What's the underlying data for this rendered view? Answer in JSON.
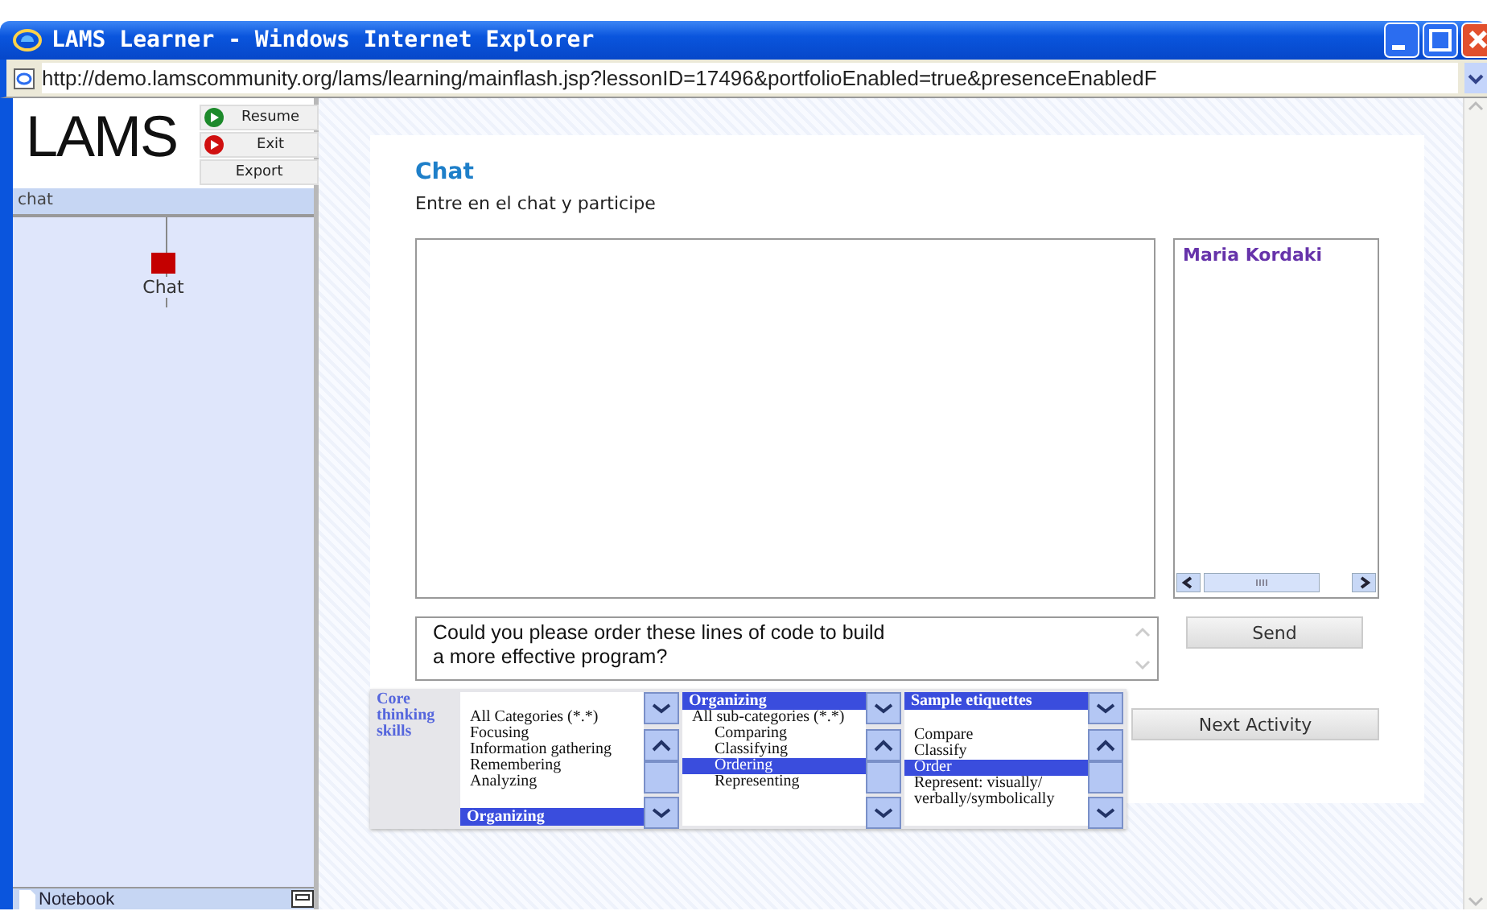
{
  "window": {
    "title": "LAMS Learner - Windows Internet Explorer",
    "address": "http://demo.lamscommunity.org/lams/learning/mainflash.jsp?lessonID=17496&portfolioEnabled=true&presenceEnabledF"
  },
  "sidebar": {
    "logo": "LAMS",
    "buttons": [
      {
        "label": "Resume",
        "kind": "resume"
      },
      {
        "label": "Exit",
        "kind": "exit"
      },
      {
        "label": "Export",
        "kind": "plain"
      }
    ],
    "section": "chat",
    "activities": [
      {
        "label": "Chat",
        "selected": true
      }
    ],
    "notebook": "Notebook"
  },
  "activity": {
    "title": "Chat",
    "instructions": "Entre en el chat y participe",
    "users": [
      "Maria Kordaki"
    ],
    "message": "Could you please order these lines of code to build\na more effective program?",
    "send": "Send",
    "next": "Next Activity"
  },
  "skills_panel": {
    "label": "Core thinking skills",
    "lists": [
      {
        "value": "Organizing",
        "kind": "trailing",
        "options": [
          {
            "label": "All Categories (*.*)",
            "selected": false
          },
          {
            "label": "Focusing",
            "selected": false
          },
          {
            "label": "Information gathering",
            "selected": false
          },
          {
            "label": "Remembering",
            "selected": false
          },
          {
            "label": "Analyzing",
            "selected": false
          }
        ]
      },
      {
        "value": "Organizing",
        "kind": "leading",
        "options": [
          {
            "label": "All sub-categories (*.*)",
            "selected": false,
            "children": [
              {
                "label": "Comparing",
                "selected": false
              },
              {
                "label": "Classifying",
                "selected": false
              },
              {
                "label": "Ordering",
                "selected": true
              },
              {
                "label": "Representing",
                "selected": false
              }
            ]
          }
        ]
      },
      {
        "value": "Sample etiquettes",
        "kind": "leading",
        "options": [
          {
            "label": "Compare",
            "selected": false
          },
          {
            "label": "Classify",
            "selected": false
          },
          {
            "label": "Order",
            "selected": true
          },
          {
            "label": "Represent: visually/ verbally/symbolically",
            "selected": false
          }
        ]
      }
    ]
  }
}
